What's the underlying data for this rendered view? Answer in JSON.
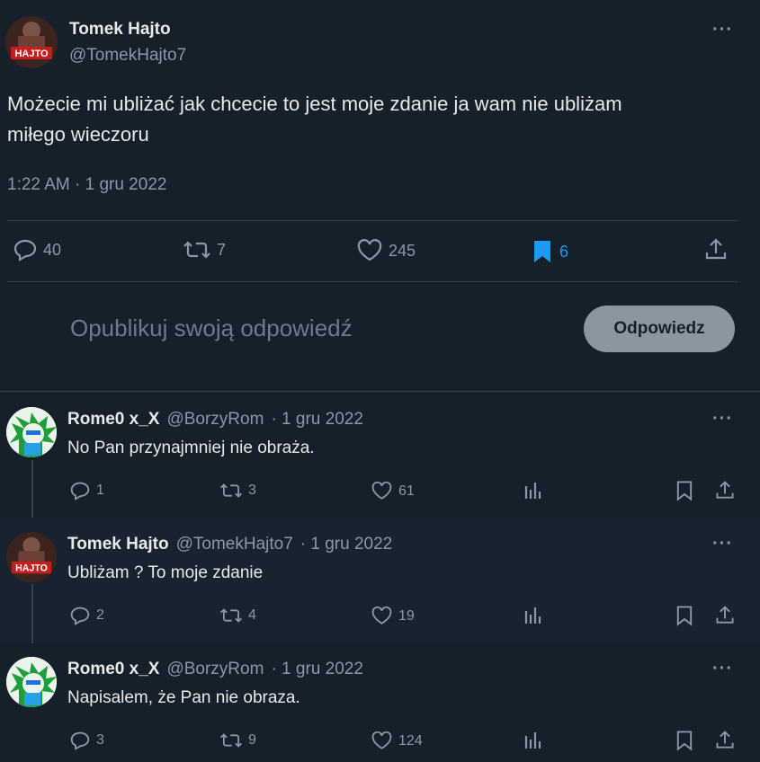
{
  "main_tweet": {
    "author_name": "Tomek Hajto",
    "author_handle": "@TomekHajto7",
    "text_line1": "Możecie mi ubliżać jak chcecie to jest moje zdanie ja wam nie ubliżam",
    "text_line2": "miłego wieczoru",
    "timestamp": "1:22 AM · 1 gru 2022",
    "stats": {
      "replies": "40",
      "retweets": "7",
      "likes": "245",
      "bookmarks": "6"
    },
    "avatar_text": "HAJTO"
  },
  "compose": {
    "placeholder": "Opublikuj swoją odpowiedź",
    "button_label": "Odpowiedz"
  },
  "replies": [
    {
      "author_name": "Rome0 x_X",
      "author_handle": "@BorzyRom",
      "date": "· 1 gru 2022",
      "text": "No Pan przynajmniej nie obraża.",
      "replies": "1",
      "retweets": "3",
      "likes": "61"
    },
    {
      "author_name": "Tomek Hajto",
      "author_handle": "@TomekHajto7",
      "date": "· 1 gru 2022",
      "text": "Ubliżam ? To moje zdanie",
      "replies": "2",
      "retweets": "4",
      "likes": "19"
    },
    {
      "author_name": "Rome0 x_X",
      "author_handle": "@BorzyRom",
      "date": "· 1 gru 2022",
      "text": "Napisalem, że Pan nie obraza.",
      "replies": "3",
      "retweets": "9",
      "likes": "124"
    }
  ],
  "icons": {
    "reply": "reply-icon",
    "retweet": "retweet-icon",
    "like": "heart-icon",
    "bookmark": "bookmark-icon",
    "share": "share-icon",
    "views": "views-icon",
    "more": "more-icon"
  },
  "colors": {
    "background": "#15202b",
    "accent": "#1d9bf0",
    "muted": "#8b98a5"
  }
}
